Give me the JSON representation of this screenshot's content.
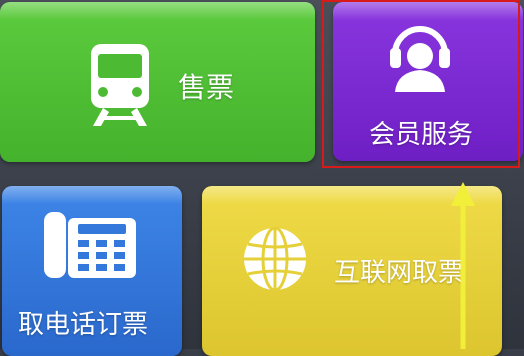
{
  "tiles": {
    "ticket": {
      "label": "售票",
      "icon": "train-icon",
      "color": "#4cbb33"
    },
    "member": {
      "label": "会员服务",
      "icon": "headset-agent-icon",
      "color": "#7a28d0"
    },
    "phone": {
      "label": "取电话订票",
      "icon": "telephone-icon",
      "color": "#3478dc"
    },
    "pickup": {
      "label": "互联网取票",
      "icon": "globe-icon",
      "color": "#e6d03a"
    }
  },
  "annotation": {
    "highlight_color": "#d81a1a",
    "arrow_color": "#f2ef3a",
    "highlighted_tile": "member"
  }
}
